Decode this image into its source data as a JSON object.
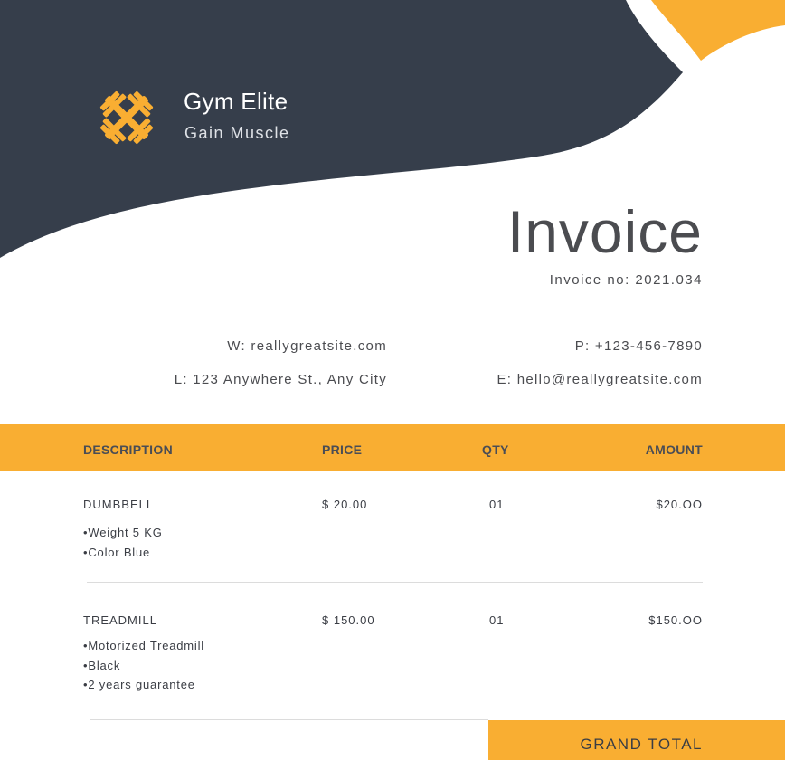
{
  "brand": {
    "name": "Gym Elite",
    "tagline": "Gain Muscle",
    "logo_icon": "crossed-dumbbells-icon"
  },
  "colors": {
    "header_bg": "#363e4b",
    "accent": "#f9ae32",
    "text": "#3a3d44"
  },
  "invoice": {
    "title": "Invoice",
    "number": "Invoice no: 2021.034"
  },
  "contact": {
    "website": "W: reallygreatsite.com",
    "location": "L: 123 Anywhere St., Any City",
    "phone": "P: +123-456-7890",
    "email": "E: hello@reallygreatsite.com"
  },
  "table": {
    "headers": {
      "description": "DESCRIPTION",
      "price": "PRICE",
      "qty": "QTY",
      "amount": "AMOUNT"
    },
    "rows": [
      {
        "name": "DUMBBELL",
        "details": [
          "Weight 5 KG",
          "Color Blue"
        ],
        "price": "$ 20.00",
        "qty": "01",
        "amount": "$20.OO"
      },
      {
        "name": "TREADMILL",
        "details": [
          "Motorized Treadmill",
          "Black",
          "2 years guarantee"
        ],
        "price": "$ 150.00",
        "qty": "01",
        "amount": "$150.OO"
      }
    ]
  },
  "grand_total": {
    "label": "GRAND TOTAL"
  }
}
